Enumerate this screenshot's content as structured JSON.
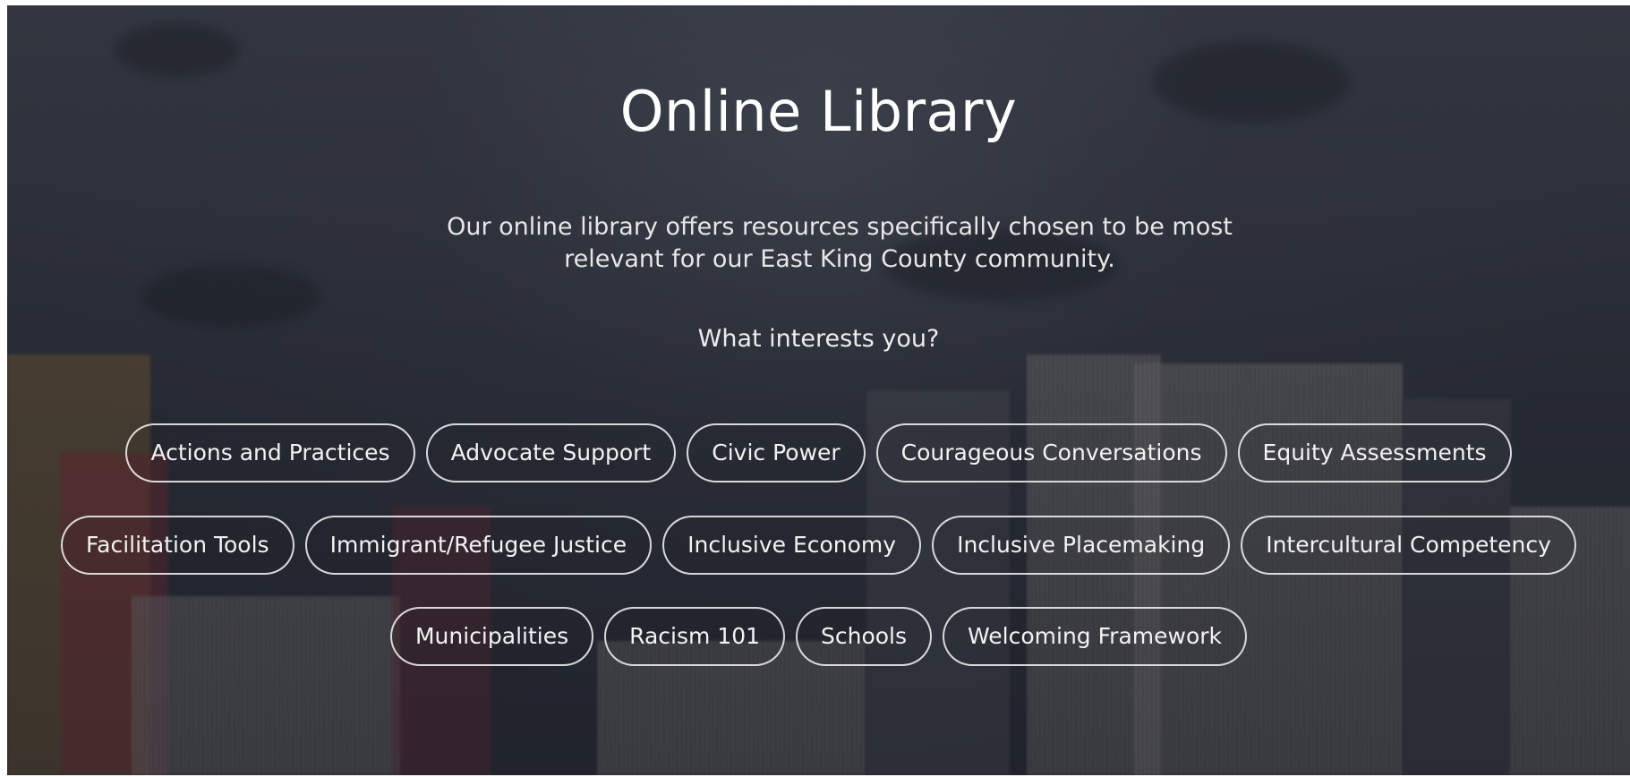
{
  "page": {
    "title": "Online Library",
    "intro": "Our online library offers resources specifically chosen to be most relevant for our East King County community.",
    "prompt": "What interests you?"
  },
  "topics": {
    "row1": [
      "Actions and Practices",
      "Advocate Support",
      "Civic Power",
      "Courageous Conversations",
      "Equity Assessments"
    ],
    "row2": [
      "Facilitation Tools",
      "Immigrant/Refugee Justice",
      "Inclusive Economy",
      "Inclusive Placemaking",
      "Intercultural Competency"
    ],
    "row3": [
      "Municipalities",
      "Racism 101",
      "Schools",
      "Welcoming Framework"
    ]
  },
  "colors": {
    "background": "#2f333d",
    "text": "#ffffff",
    "tag_border": "#ebebeb"
  }
}
